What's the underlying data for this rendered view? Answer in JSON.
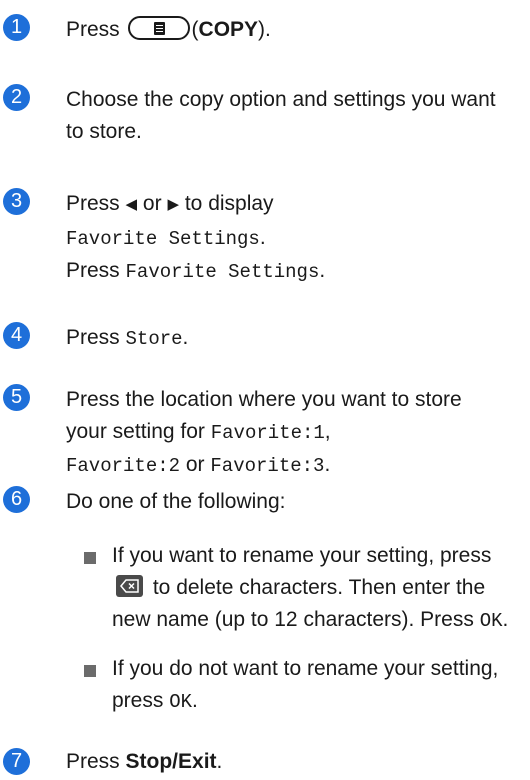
{
  "steps": [
    {
      "num": "1",
      "press": "Press",
      "key_name": "COPY",
      "key_open": "(",
      "key_close": ")."
    },
    {
      "num": "2",
      "text": "Choose the copy option and settings you want to store."
    },
    {
      "num": "3",
      "press": "Press",
      "or": "or",
      "to_display": "to display",
      "option": "Favorite Settings",
      "period": ".",
      "press2": "Press"
    },
    {
      "num": "4",
      "press": "Press",
      "option": "Store",
      "period": "."
    },
    {
      "num": "5",
      "lead": "Press the location where you want to store your setting for",
      "fav1": "Favorite:1",
      "comma": ",",
      "fav2": "Favorite:2",
      "or": "or",
      "fav3": "Favorite:3",
      "period": "."
    },
    {
      "num": "6",
      "text": "Do one of the following:",
      "bullets": [
        {
          "a": "If you want to rename your setting, press",
          "b": "to delete characters. Then enter the new name (up to 12 characters). Press",
          "ok": "OK",
          "end": "."
        },
        {
          "a": "If you do not want to rename your setting, press",
          "ok": "OK",
          "end": "."
        }
      ]
    },
    {
      "num": "7",
      "press": "Press",
      "key_name": "Stop/Exit",
      "period": "."
    }
  ],
  "icons": {
    "copy_key": "copy-document-icon",
    "backspace_key": "backspace-icon",
    "left_arrow": "left-triangle-icon",
    "right_arrow": "right-triangle-icon"
  },
  "colors": {
    "step_badge": "#1e6fd9"
  }
}
